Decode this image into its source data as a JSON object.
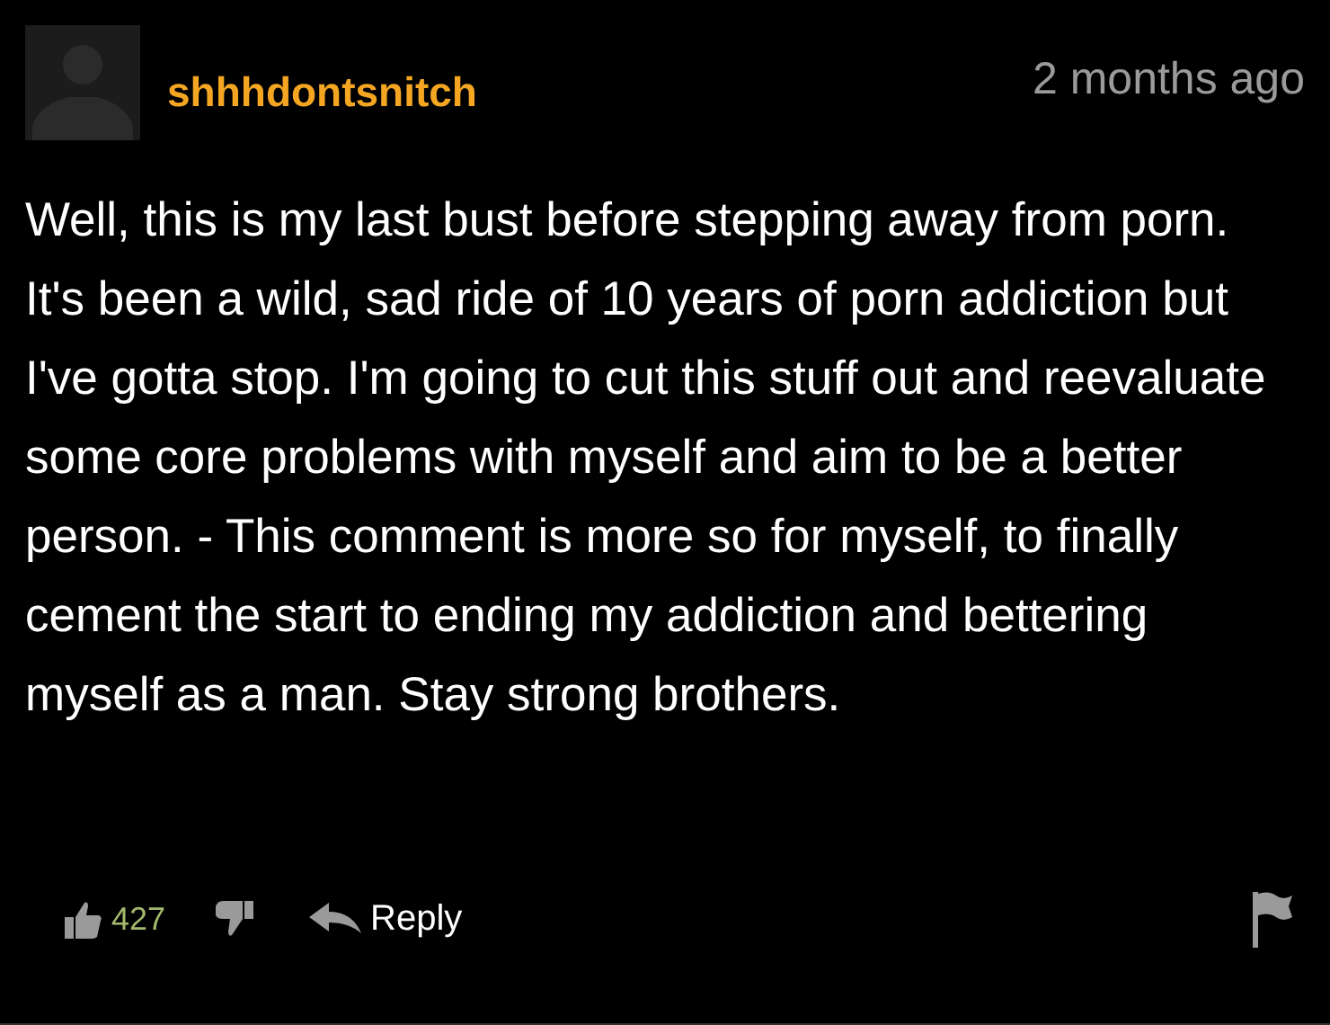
{
  "comment": {
    "username": "shhhdontsnitch",
    "time": "2 months ago",
    "text": "Well, this is my last bust before stepping away from porn. It's been a wild, sad ride of 10 years of porn addiction but I've gotta stop. I'm going to cut this stuff out and reevaluate some core problems with myself and aim to be a better person. - This comment is more so for myself, to finally cement the start to ending my addiction and bettering myself as a man. Stay strong brothers.",
    "likes": "427",
    "reply": "Reply"
  }
}
